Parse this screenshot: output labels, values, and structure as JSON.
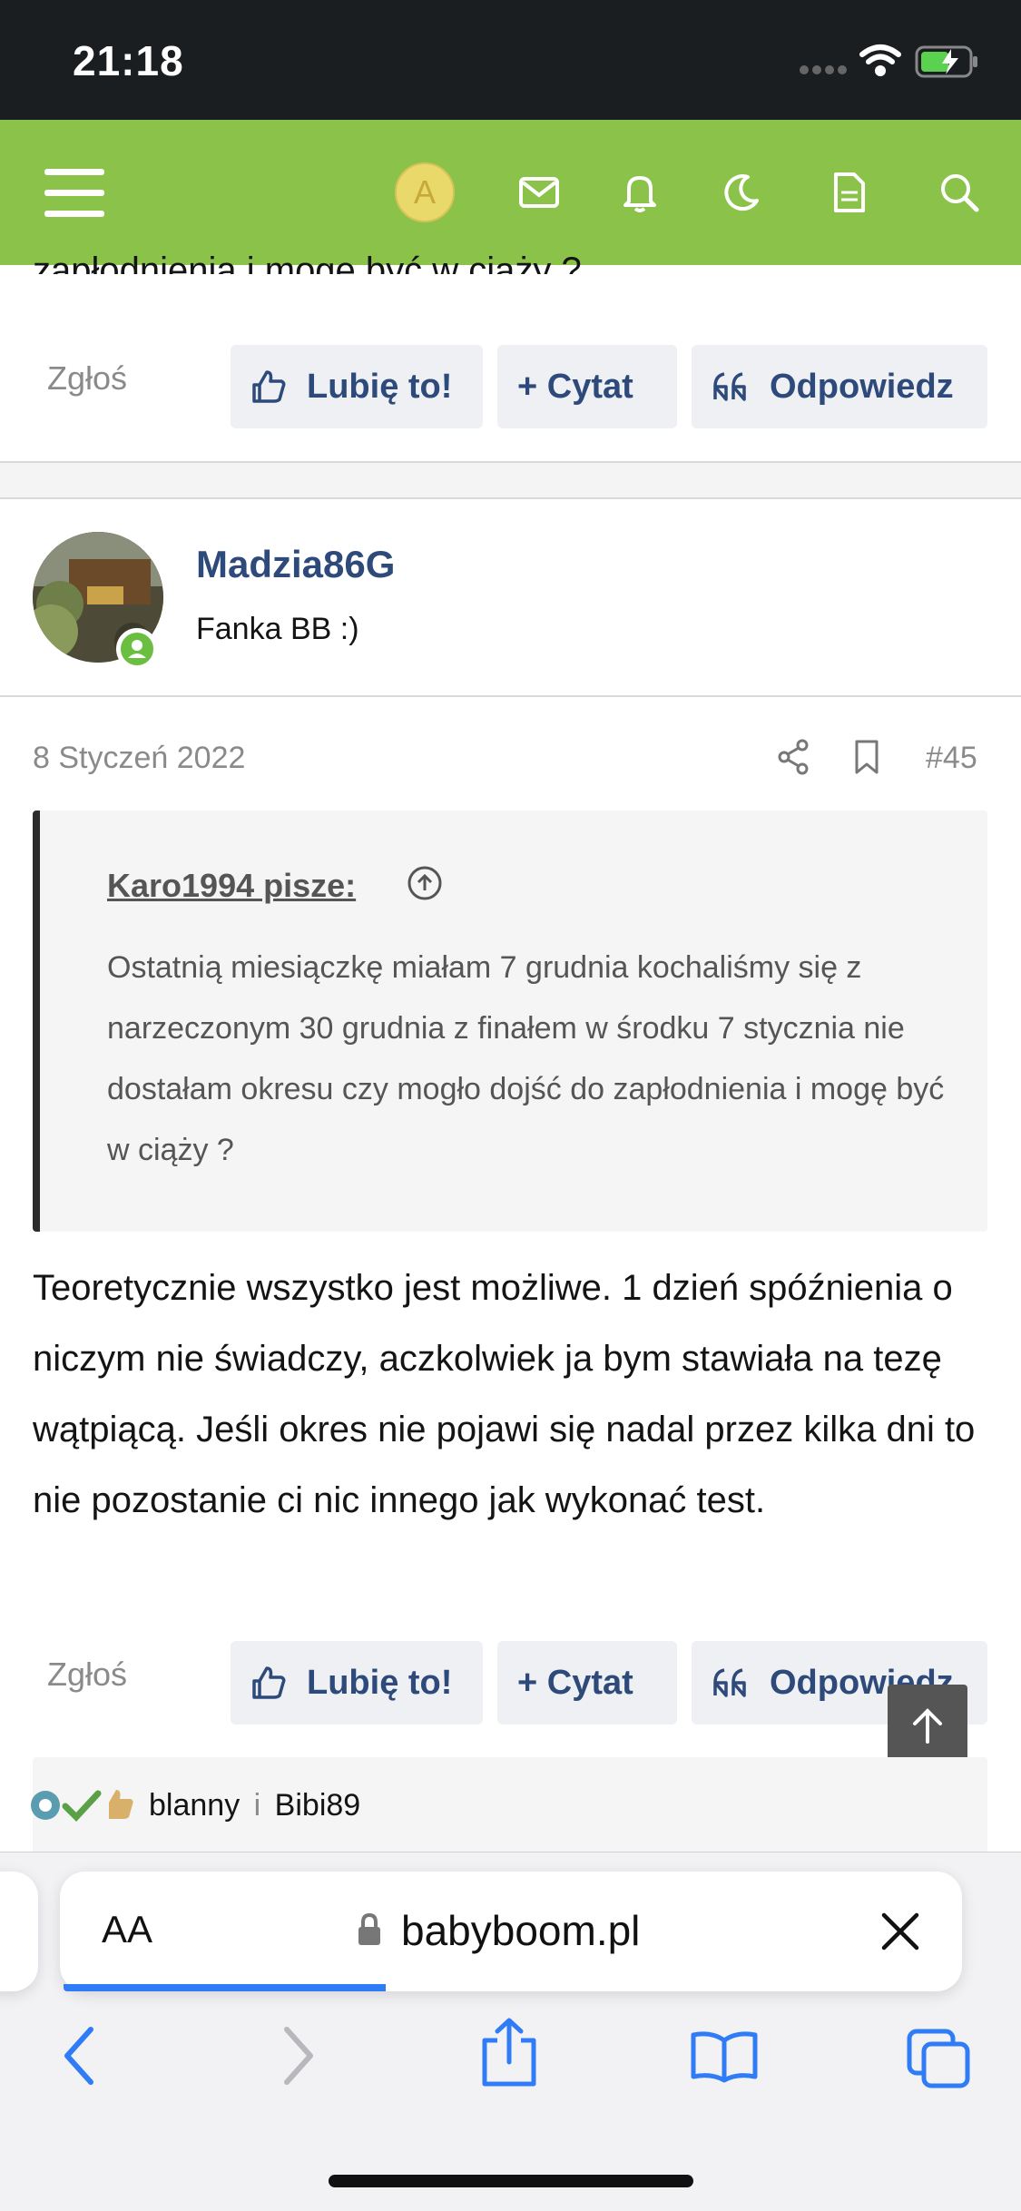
{
  "status_bar": {
    "time": "21:18"
  },
  "nav": {
    "avatar_letter": "A",
    "icons": [
      "menu-icon",
      "avatar",
      "mail-icon",
      "bell-icon",
      "moon-icon",
      "document-icon",
      "search-icon"
    ],
    "accent_color": "#8bc34a"
  },
  "prev_post": {
    "tail_text": "zapłodnienia i mogę być w ciąży ?",
    "report_label": "Zgłoś",
    "like_label": "Lubię to!",
    "quote_label": "+ Cytat",
    "reply_label": "Odpowiedz"
  },
  "post": {
    "author": "Madzia86G",
    "author_title": "Fanka BB :)",
    "date": "8 Styczeń 2022",
    "number": "#45",
    "quote": {
      "author": "Karo1994 pisze:",
      "text": "Ostatnią miesiączkę miałam 7 grudnia kochaliśmy się z narzeczonym 30 grudnia z finałem w środku 7 stycznia nie dostałam okresu czy mogło dojść do zapłodnienia i mogę być w ciąży ?"
    },
    "body": "Teoretycznie wszystko jest możliwe. 1 dzień spóźnienia o niczym nie świadczy, aczkolwiek ja bym stawiała na tezę wątpiącą. Jeśli okres nie pojawi się nadal przez kilka dni to nie pozostanie ci nic innego jak wykonać test.",
    "report_label": "Zgłoś",
    "like_label": "Lubię to!",
    "quote_label": "+ Cytat",
    "reply_label": "Odpowiedz",
    "reactions": {
      "user1": "blanny",
      "separator": "i",
      "user2": "Bibi89"
    }
  },
  "browser": {
    "aa_label": "AA",
    "url": "babyboom.pl",
    "load_progress": 0.36
  }
}
